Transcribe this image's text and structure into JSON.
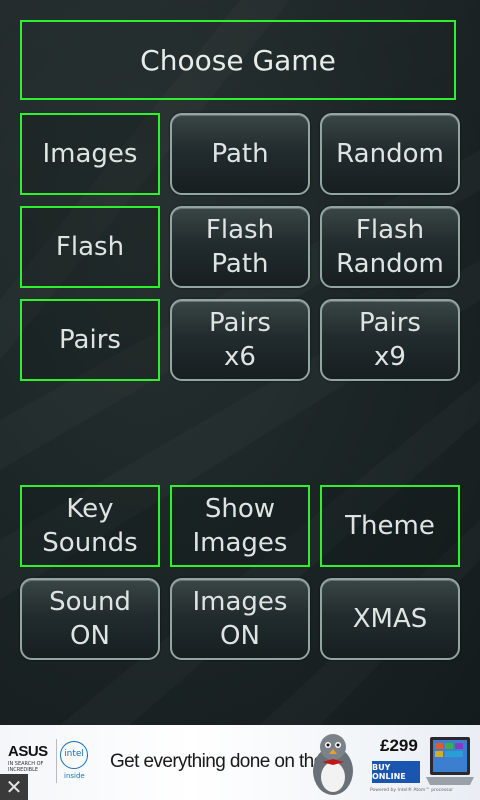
{
  "header": {
    "title": "Choose Game"
  },
  "game_modes": [
    {
      "label": "Images",
      "selected": true
    },
    {
      "label": "Path",
      "selected": false
    },
    {
      "label": "Random",
      "selected": false
    },
    {
      "label": "Flash",
      "selected": true
    },
    {
      "label": "Flash\nPath",
      "selected": false
    },
    {
      "label": "Flash\nRandom",
      "selected": false
    },
    {
      "label": "Pairs",
      "selected": true
    },
    {
      "label": "Pairs\nx6",
      "selected": false
    },
    {
      "label": "Pairs\nx9",
      "selected": false
    }
  ],
  "settings": [
    {
      "label": "Key\nSounds",
      "selected": true
    },
    {
      "label": "Show\nImages",
      "selected": true
    },
    {
      "label": "Theme",
      "selected": true
    },
    {
      "label": "Sound\nON",
      "selected": false
    },
    {
      "label": "Images\nON",
      "selected": false
    },
    {
      "label": "XMAS",
      "selected": false
    }
  ],
  "ad": {
    "brand": "ASUS",
    "brand_tagline": "IN SEARCH OF INCREDIBLE",
    "intel_label": "intel",
    "intel_inside": "inside",
    "headline": "Get everything done on the fly",
    "price": "£299",
    "cta": "BUY ONLINE",
    "fine_print": "Powered by Intel® Atom™ processor",
    "close_glyph": "✕"
  },
  "colors": {
    "selected_border": "#2ef02e",
    "button_border": "#93a5a1",
    "background": "#1a2324",
    "text": "#dfe4e2",
    "ad_cta": "#1a56b0"
  }
}
